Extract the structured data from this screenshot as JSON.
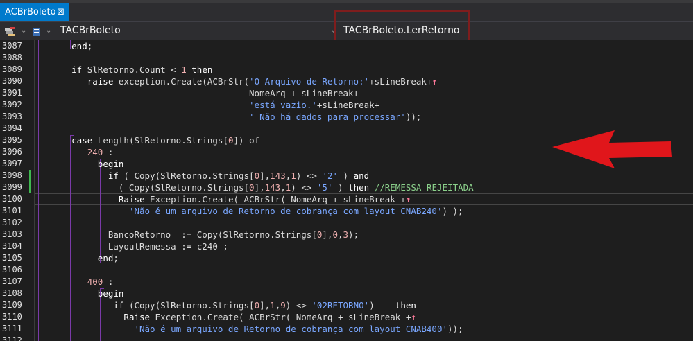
{
  "tab": {
    "label": "ACBrBoleto",
    "close": "⊠"
  },
  "nav": {
    "class_name": "TACBrBoleto",
    "method_name": "TACBrBoleto.LerRetorno"
  },
  "colors": {
    "tab_active": "#007acc",
    "highlight_box": "#7f1d1d",
    "arrow": "#e0161b",
    "changed_line_marker": "#3fb950"
  },
  "editor": {
    "line_numbers": [
      "3087",
      "3088",
      "3089",
      "3090",
      "3091",
      "3092",
      "3093",
      "3094",
      "3095",
      "3096",
      "3097",
      "3098",
      "3099",
      "3100",
      "3101",
      "3102",
      "3103",
      "3104",
      "3105",
      "3106",
      "3107",
      "3108",
      "3109",
      "3110",
      "3111",
      "3112"
    ],
    "lines": [
      "      end;",
      "",
      "      if SlRetorno.Count < 1 then",
      "         raise exception.Create(ACBrStr('O Arquivo de Retorno:'+sLineBreak+↑",
      "                                        NomeArq + sLineBreak+",
      "                                        'está vazio.'+sLineBreak+",
      "                                        ' Não há dados para processar'));",
      "",
      "      case Length(SlRetorno.Strings[0]) of",
      "         240 :",
      "           begin",
      "             if ( Copy(SlRetorno.Strings[0],143,1) <> '2' ) and",
      "               ( Copy(SlRetorno.Strings[0],143,1) <> '5' ) then //REMESSA REJEITADA",
      "               Raise Exception.Create( ACBrStr( NomeArq + sLineBreak +↑",
      "                 'Não é um arquivo de Retorno de cobrança com layout CNAB240') );",
      "",
      "             BancoRetorno  := Copy(SlRetorno.Strings[0],0,3);",
      "             LayoutRemessa := c240 ;",
      "           end;",
      "",
      "         400 :",
      "           begin",
      "              if (Copy(SlRetorno.Strings[0],1,9) <> '02RETORNO')    then",
      "                Raise Exception.Create( ACBrStr( NomeArq + sLineBreak +↑",
      "                  'Não é um arquivo de Retorno de cobrança com layout CNAB400'));",
      ""
    ]
  }
}
